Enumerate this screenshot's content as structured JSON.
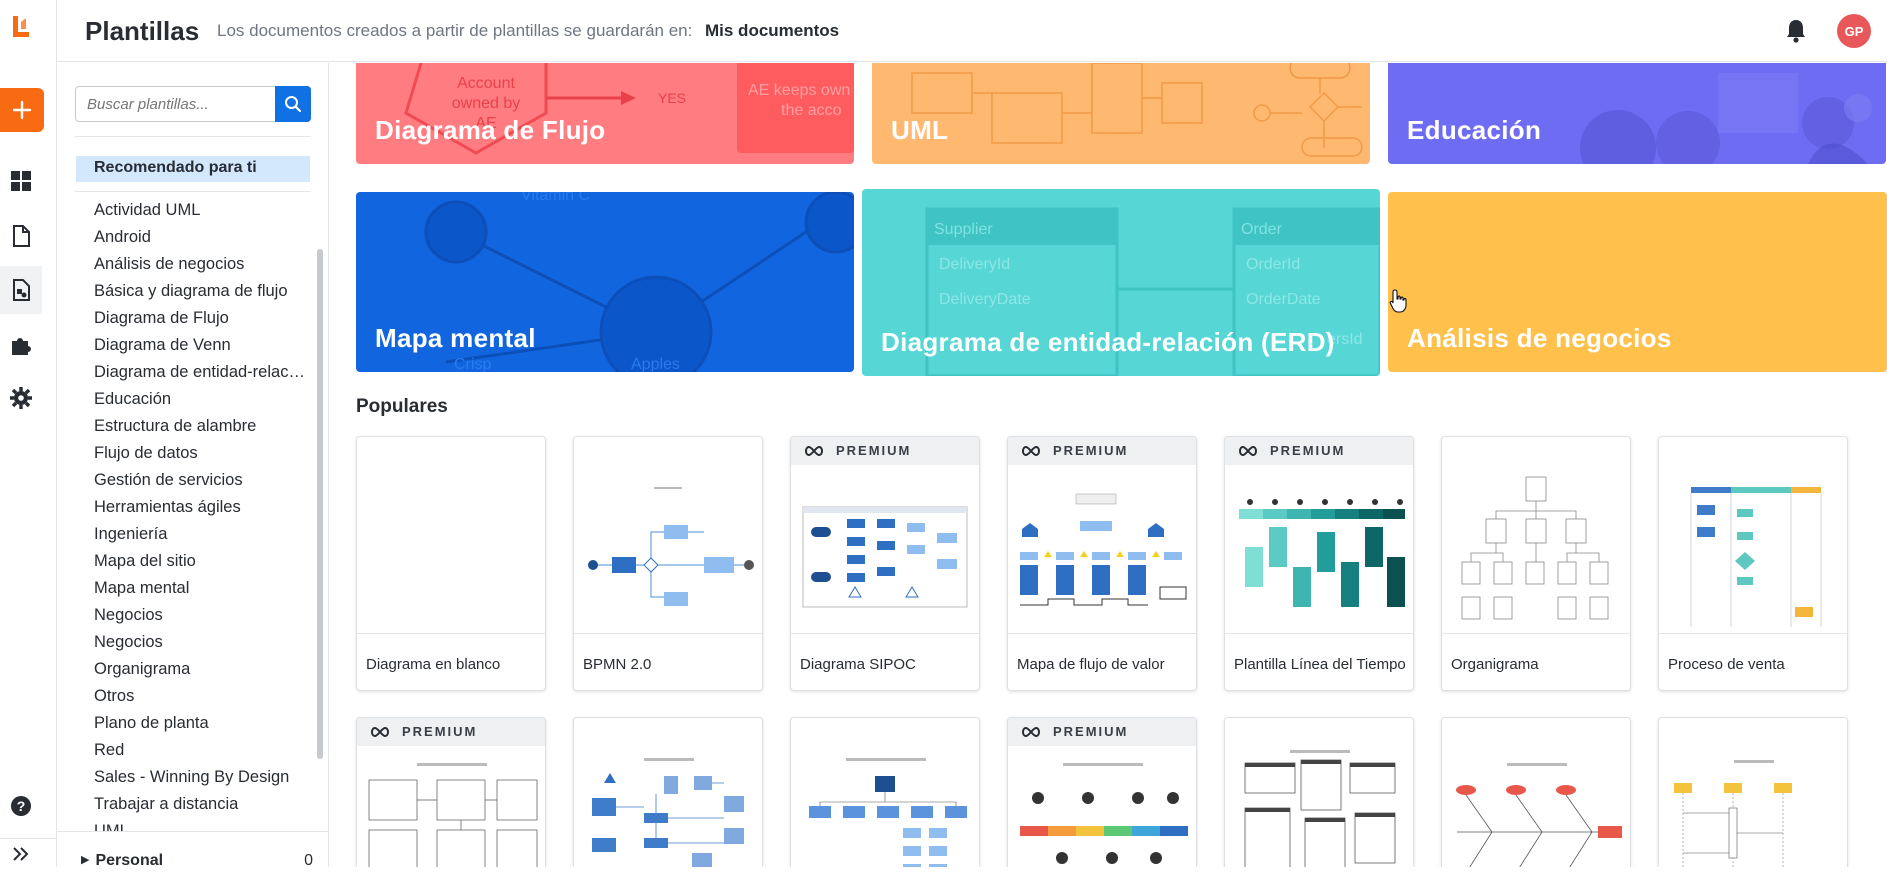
{
  "app": {
    "logo_color": "#f96b13",
    "accent": "#1071e5",
    "create_color": "#f96b13"
  },
  "rail": {
    "icons": [
      "lucid-logo-icon",
      "plus-icon",
      "dashboard-icon",
      "document-icon",
      "templates-icon",
      "puzzle-icon",
      "settings-icon",
      "help-icon",
      "expand-icon"
    ]
  },
  "header": {
    "title": "Plantillas",
    "subtitle": "Los documentos creados a partir de plantillas se guardarán en:",
    "location": "Mis documentos",
    "avatar_initials": "GP",
    "avatar_color": "#e8575a"
  },
  "sidebar": {
    "search_placeholder": "Buscar plantillas...",
    "recommended": "Recomendado para ti",
    "categories": [
      "Actividad UML",
      "Android",
      "Análisis de negocios",
      "Básica y diagrama de flujo",
      "Diagrama de Flujo",
      "Diagrama de Venn",
      "Diagrama de entidad-relación (ERD)",
      "Educación",
      "Estructura de alambre",
      "Flujo de datos",
      "Gestión de servicios",
      "Herramientas ágiles",
      "Ingeniería",
      "Mapa del sitio",
      "Mapa mental",
      "Negocios",
      "Negocios",
      "Organigrama",
      "Otros",
      "Plano de planta",
      "Red",
      "Sales - Winning By Design",
      "Trabajar a distancia",
      "UML"
    ],
    "personal_label": "Personal",
    "personal_count": "0"
  },
  "category_cards": [
    {
      "label": "Diagrama de Flujo",
      "color": "#ff7c80",
      "bg_texts": [
        "Account",
        "owned by",
        "AE",
        "YES",
        "AE keeps own",
        "the acco"
      ]
    },
    {
      "label": "UML",
      "color": "#ffb870"
    },
    {
      "label": "Educación",
      "color": "#6e6cf2"
    },
    {
      "label": "Mapa mental",
      "color": "#1166e0",
      "bg_texts": [
        "Vitamin C",
        "Crisp",
        "Apples"
      ]
    },
    {
      "label": "Diagrama de entidad-relación (ERD)",
      "color": "#57d6d6",
      "bg_texts": [
        "Supplier",
        "DeliveryId",
        "DeliveryDate",
        "Order",
        "OrderId",
        "OrderDate",
        "ersId"
      ]
    },
    {
      "label": "Análisis de negocios",
      "color": "#ffbe47"
    }
  ],
  "popular": {
    "title": "Populares",
    "premium_label": "PREMIUM",
    "row1": [
      {
        "name": "Diagrama en blanco",
        "premium": false
      },
      {
        "name": "BPMN 2.0",
        "premium": false
      },
      {
        "name": "Diagrama SIPOC",
        "premium": true
      },
      {
        "name": "Mapa de flujo de valor",
        "premium": true
      },
      {
        "name": "Plantilla Línea del Tiempo",
        "premium": true
      },
      {
        "name": "Organigrama",
        "premium": false
      },
      {
        "name": "Proceso de venta",
        "premium": false
      }
    ],
    "row2": [
      {
        "premium": true
      },
      {
        "premium": false
      },
      {
        "premium": false
      },
      {
        "premium": true
      },
      {
        "premium": false
      },
      {
        "premium": false
      },
      {
        "premium": false
      }
    ]
  }
}
